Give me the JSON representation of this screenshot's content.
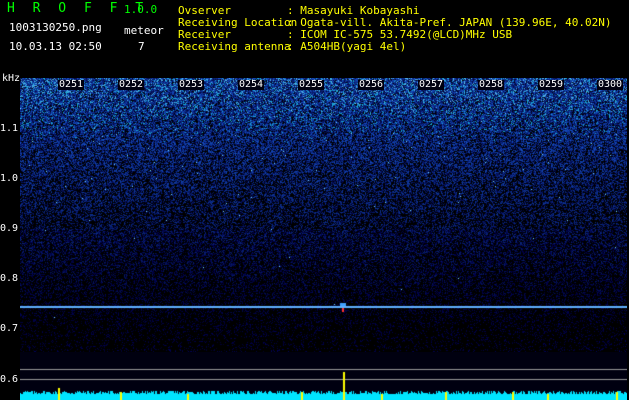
{
  "header": {
    "app_title": "H R O F F T",
    "version": "1.0.0",
    "file_name": "1003130250.png",
    "meteor_label": "meteor",
    "date_time": "10.03.13 02:50",
    "meteor_count": "7"
  },
  "info": [
    {
      "label": "Ovserver",
      "value": ": Masayuki Kobayashi"
    },
    {
      "label": "Receiving Location",
      "value": ": Ogata-vill. Akita-Pref. JAPAN (139.96E, 40.02N)"
    },
    {
      "label": "Receiver",
      "value": ": ICOM IC-575 53.7492(@LCD)MHz USB"
    },
    {
      "label": "Receiving antenna",
      "value": ": A504HB(yagi 4el)"
    }
  ],
  "y_axis": {
    "unit": "kHz",
    "labels": [
      "1.1",
      "1.0",
      "0.9",
      "0.8",
      "0.7",
      "0.6"
    ]
  },
  "time_axis": {
    "labels": [
      "0251",
      "0252",
      "0253",
      "0254",
      "0255",
      "0256",
      "0257",
      "0258",
      "0259",
      "0300"
    ]
  },
  "colors": {
    "background": "#000000",
    "noise_deep": "#101a8c",
    "noise_bright": "#4a8cff",
    "carrier": "#5fb0ff",
    "meteor_trace": "#ffff00",
    "bottom_level": "#00e5ff",
    "title_green": "#00ff00",
    "info_yellow": "#ffff00"
  }
}
